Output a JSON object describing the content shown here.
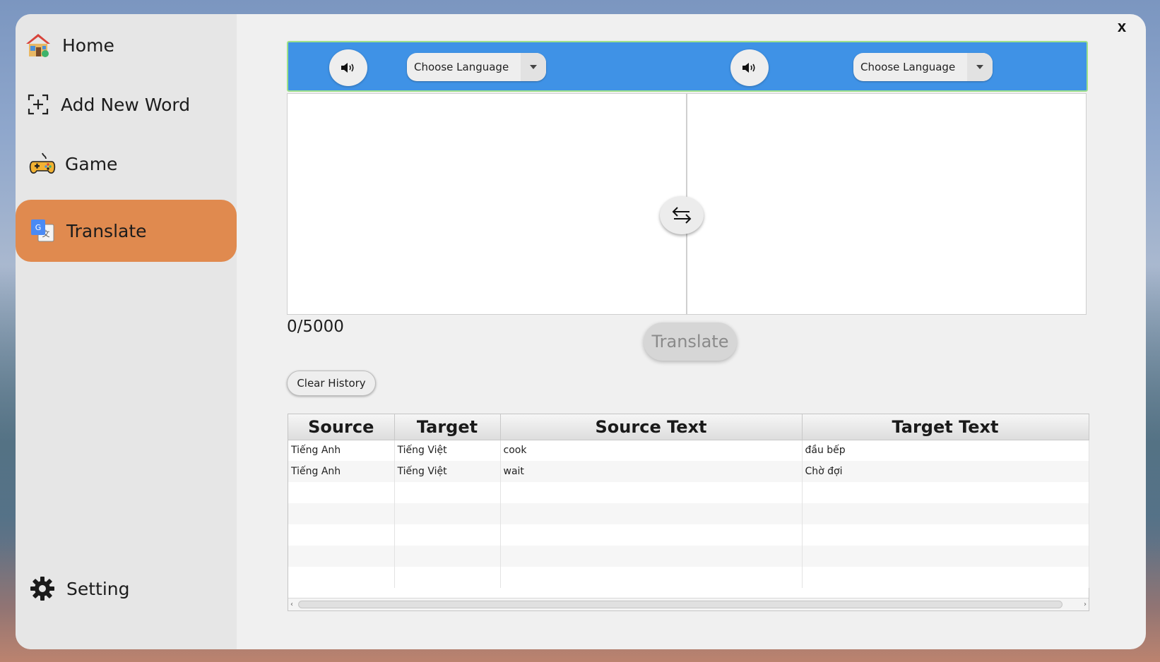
{
  "window": {
    "close_label": "x"
  },
  "sidebar": {
    "items": [
      {
        "label": "Home",
        "icon": "home-icon"
      },
      {
        "label": "Add New Word",
        "icon": "add-word-icon"
      },
      {
        "label": "Game",
        "icon": "gamepad-icon"
      },
      {
        "label": "Translate",
        "icon": "google-translate-icon",
        "active": true
      },
      {
        "label": "Setting",
        "icon": "gear-icon"
      }
    ],
    "active_color": "#e08a4f"
  },
  "translator": {
    "accent_color": "#3f92e6",
    "source_language": {
      "placeholder": "Choose Language"
    },
    "target_language": {
      "placeholder": "Choose Language"
    },
    "source_text": "",
    "target_text": "",
    "char_counter": "0/5000",
    "translate_label": "Translate"
  },
  "history": {
    "clear_label": "Clear History",
    "columns": [
      "Source",
      "Target",
      "Source Text",
      "Target Text"
    ],
    "rows": [
      [
        "Tiếng Anh",
        "Tiếng Việt",
        "cook",
        "đầu bếp"
      ],
      [
        "Tiếng Anh",
        "Tiếng Việt",
        "wait",
        "Chờ đợi"
      ]
    ]
  }
}
